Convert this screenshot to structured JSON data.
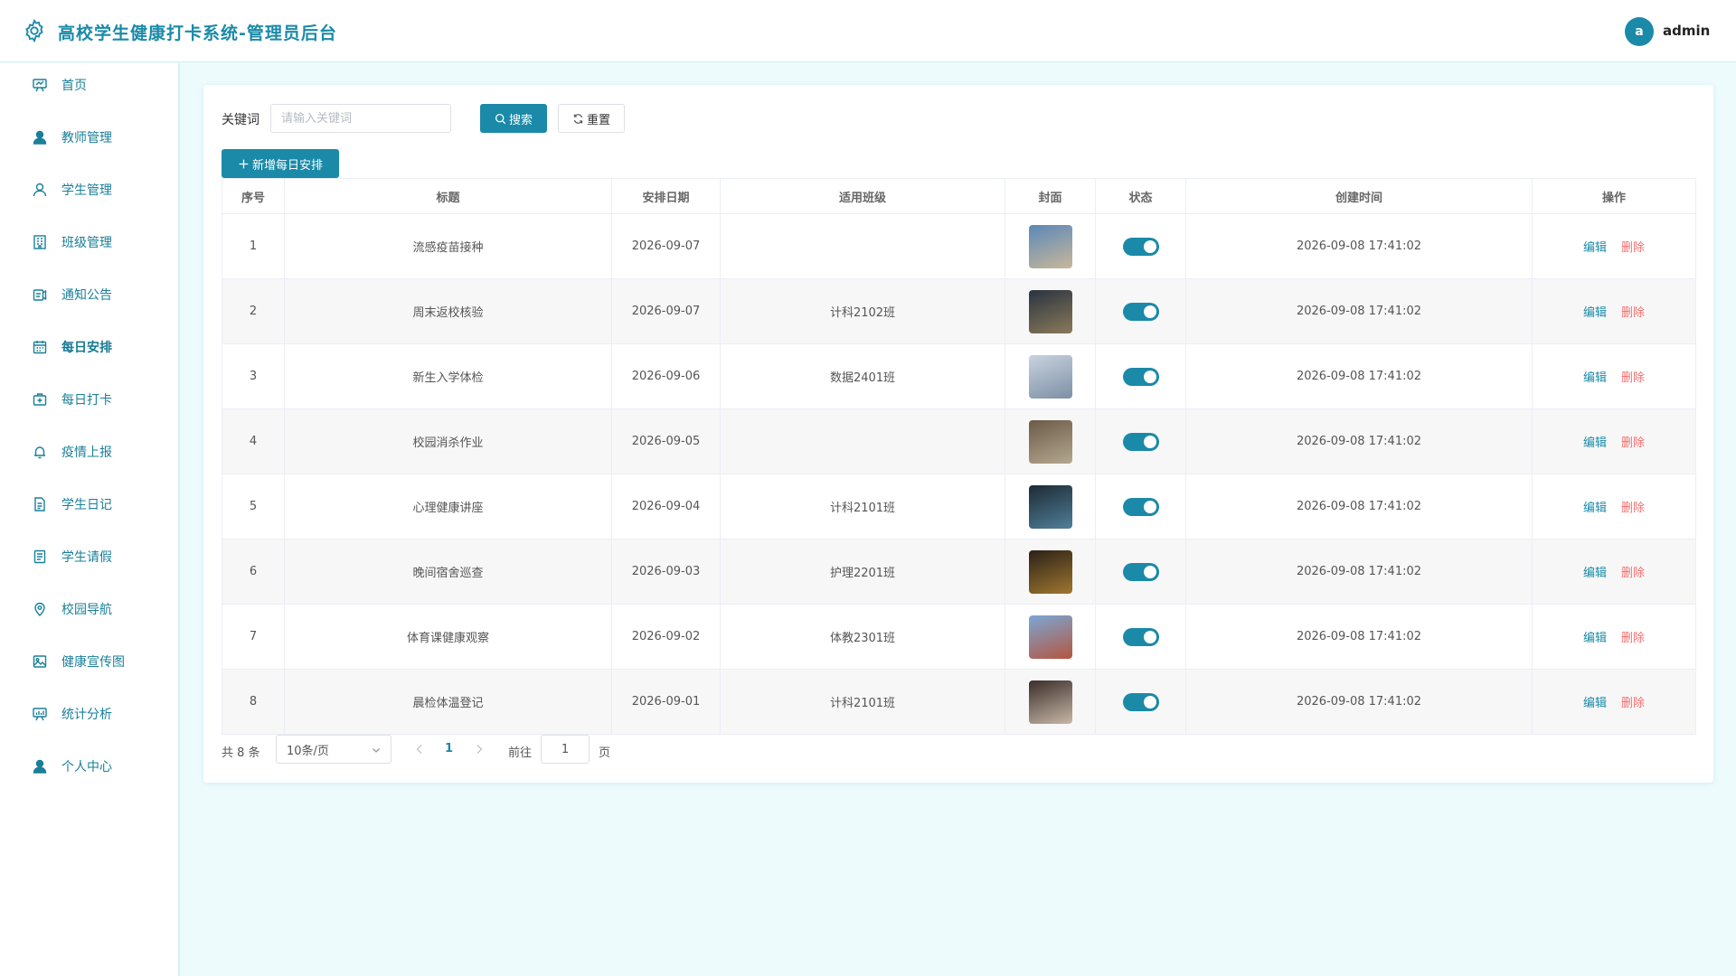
{
  "header": {
    "title": "高校学生健康打卡系统-管理员后台",
    "avatar_letter": "a",
    "username": "admin"
  },
  "sidebar": {
    "items": [
      {
        "key": "home",
        "label": "首页",
        "icon": "chart-board-icon"
      },
      {
        "key": "teacher",
        "label": "教师管理",
        "icon": "user-filled-icon"
      },
      {
        "key": "student",
        "label": "学生管理",
        "icon": "user-icon"
      },
      {
        "key": "class",
        "label": "班级管理",
        "icon": "building-icon"
      },
      {
        "key": "notice",
        "label": "通知公告",
        "icon": "notice-icon"
      },
      {
        "key": "schedule",
        "label": "每日安排",
        "icon": "calendar-icon",
        "active": true
      },
      {
        "key": "checkin",
        "label": "每日打卡",
        "icon": "first-aid-kit-icon"
      },
      {
        "key": "epidemic",
        "label": "疫情上报",
        "icon": "bell-icon"
      },
      {
        "key": "diary",
        "label": "学生日记",
        "icon": "document-icon"
      },
      {
        "key": "leave",
        "label": "学生请假",
        "icon": "tickets-icon"
      },
      {
        "key": "navigation",
        "label": "校园导航",
        "icon": "location-icon"
      },
      {
        "key": "banner",
        "label": "健康宣传图",
        "icon": "picture-icon"
      },
      {
        "key": "stats",
        "label": "统计分析",
        "icon": "data-board-icon"
      },
      {
        "key": "profile",
        "label": "个人中心",
        "icon": "user-filled-icon"
      }
    ]
  },
  "search": {
    "label": "关键词",
    "placeholder": "请输入关键词",
    "value": "",
    "search_button": "搜索",
    "reset_button": "重置"
  },
  "add_button": "新增每日安排",
  "table": {
    "columns": [
      "序号",
      "标题",
      "安排日期",
      "适用班级",
      "封面",
      "状态",
      "创建时间",
      "操作"
    ],
    "edit_label": "编辑",
    "delete_label": "删除",
    "rows": [
      {
        "index": "1",
        "title": "流感疫苗接种",
        "date": "2026-09-07",
        "class": "",
        "status": true,
        "created": "2026-09-08 17:41:02",
        "cover": [
          "#5b88b8",
          "#c9b79a"
        ]
      },
      {
        "index": "2",
        "title": "周末返校核验",
        "date": "2026-09-07",
        "class": "计科2102班",
        "status": true,
        "created": "2026-09-08 17:41:02",
        "cover": [
          "#2a3340",
          "#8a7a5a"
        ]
      },
      {
        "index": "3",
        "title": "新生入学体检",
        "date": "2026-09-06",
        "class": "数据2401班",
        "status": true,
        "created": "2026-09-08 17:41:02",
        "cover": [
          "#c9d3df",
          "#7d8fa6"
        ]
      },
      {
        "index": "4",
        "title": "校园消杀作业",
        "date": "2026-09-05",
        "class": "",
        "status": true,
        "created": "2026-09-08 17:41:02",
        "cover": [
          "#6b5a48",
          "#b4a88f"
        ]
      },
      {
        "index": "5",
        "title": "心理健康讲座",
        "date": "2026-09-04",
        "class": "计科2101班",
        "status": true,
        "created": "2026-09-08 17:41:02",
        "cover": [
          "#1e2a33",
          "#4f7f9a"
        ]
      },
      {
        "index": "6",
        "title": "晚间宿舍巡查",
        "date": "2026-09-03",
        "class": "护理2201班",
        "status": true,
        "created": "2026-09-08 17:41:02",
        "cover": [
          "#2b2118",
          "#a0772f"
        ]
      },
      {
        "index": "7",
        "title": "体育课健康观察",
        "date": "2026-09-02",
        "class": "体教2301班",
        "status": true,
        "created": "2026-09-08 17:41:02",
        "cover": [
          "#7aa7d6",
          "#b5563e"
        ]
      },
      {
        "index": "8",
        "title": "晨检体温登记",
        "date": "2026-09-01",
        "class": "计科2101班",
        "status": true,
        "created": "2026-09-08 17:41:02",
        "cover": [
          "#3a2e2a",
          "#c9b8a8"
        ]
      }
    ]
  },
  "pagination": {
    "total_text": "共 8 条",
    "page_size": "10条/页",
    "current_page": "1",
    "goto_label": "前往",
    "goto_value": "1",
    "page_suffix": "页"
  },
  "colors": {
    "primary": "#1a8aa8",
    "danger": "#f56c6c",
    "background": "#eefbfd"
  }
}
